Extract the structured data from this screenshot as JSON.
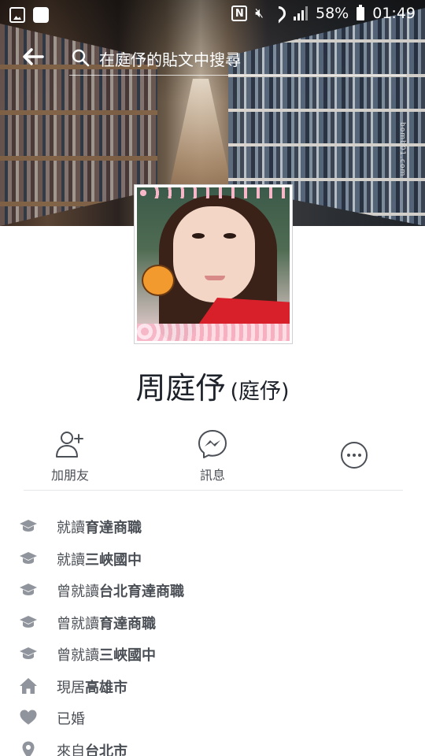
{
  "status_bar": {
    "battery": "58%",
    "time": "01:49",
    "icons": [
      "gallery-icon",
      "app-icon",
      "nfc-icon",
      "mute-icon",
      "wifi-icon",
      "signal-icon",
      "battery-icon"
    ]
  },
  "header": {
    "back_icon": "arrow-left-icon",
    "search_placeholder": "在庭伃的貼文中搜尋"
  },
  "cover": {
    "watermark": "bomb01.com"
  },
  "profile": {
    "name": "周庭伃",
    "alternate_name": "(庭伃)"
  },
  "actions": [
    {
      "icon": "add-friend-icon",
      "label": "加朋友"
    },
    {
      "icon": "messenger-icon",
      "label": "訊息"
    },
    {
      "icon": "more-icon",
      "label": ""
    }
  ],
  "intro": [
    {
      "icon": "education-icon",
      "prefix": "就讀",
      "value": "育達商職"
    },
    {
      "icon": "education-icon",
      "prefix": "就讀",
      "value": "三峽國中"
    },
    {
      "icon": "education-icon",
      "prefix": "曾就讀",
      "value": "台北育達商職"
    },
    {
      "icon": "education-icon",
      "prefix": "曾就讀",
      "value": "育達商職"
    },
    {
      "icon": "education-icon",
      "prefix": "曾就讀",
      "value": "三峽國中"
    },
    {
      "icon": "home-icon",
      "prefix": "現居",
      "value": "高雄市"
    },
    {
      "icon": "heart-icon",
      "prefix": "已婚",
      "value": ""
    },
    {
      "icon": "location-pin-icon",
      "prefix": "來自",
      "value": "台北市"
    }
  ],
  "colors": {
    "text_primary": "#1d2129",
    "text_secondary": "#4b4f56",
    "icon_gray": "#90949c",
    "divider": "#e5e6e9"
  }
}
